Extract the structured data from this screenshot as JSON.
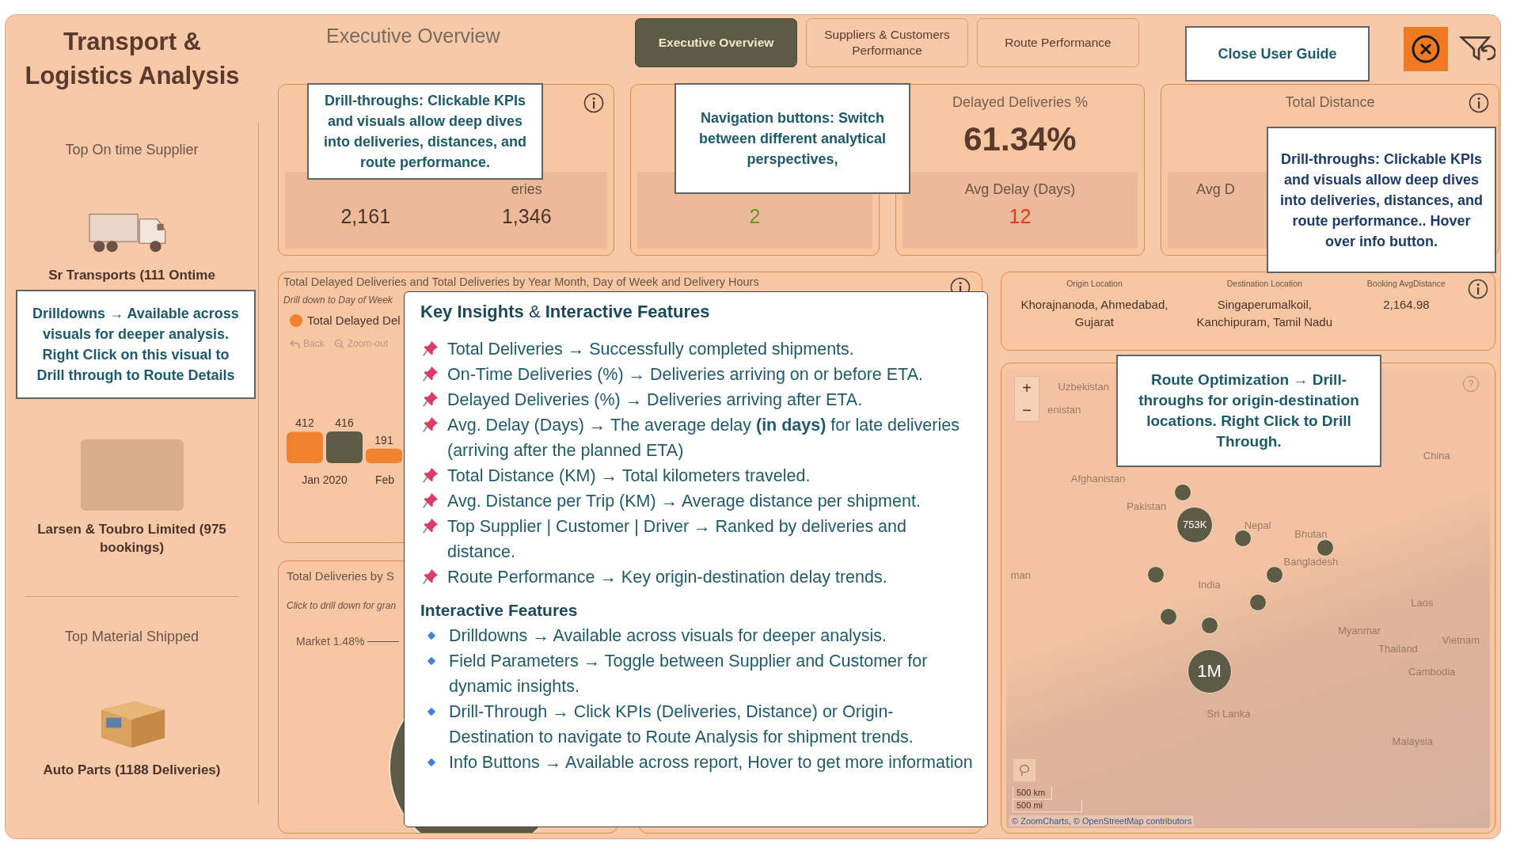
{
  "sidebar": {
    "title": "Transport & Logistics Analysis",
    "sections": [
      {
        "heading": "Top On time Supplier",
        "kind": "truck",
        "caption": "Sr Transports (111 Ontime"
      },
      {
        "kind": "photo",
        "caption": "Larsen & Toubro Limited (975 bookings)"
      },
      {
        "heading": "Top Material Shipped",
        "kind": "box",
        "caption": "Auto Parts (1188 Deliveries)"
      }
    ]
  },
  "header": {
    "title": "Executive Overview",
    "tabs": [
      {
        "label": "Executive Overview",
        "selected": true
      },
      {
        "label": "Suppliers & Customers Performance",
        "selected": false
      },
      {
        "label": "Route Performance",
        "selected": false
      }
    ]
  },
  "kpis": [
    {
      "info_button": true,
      "subs": [
        {
          "value": "2,161"
        },
        {
          "label": "eries",
          "value": "1,346"
        }
      ]
    },
    {
      "info_button": false,
      "subs": [
        {
          "value": "2",
          "color": "#5f9a1c"
        }
      ]
    },
    {
      "info_button": false,
      "title": "Delayed Deliveries %",
      "value": "61.34%",
      "subs": [
        {
          "label": "Avg Delay (Days)",
          "value": "12",
          "color": "#e8381c"
        }
      ]
    },
    {
      "info_button": true,
      "title": "Total Distance",
      "subs": [
        {
          "label": "Avg D"
        }
      ]
    }
  ],
  "delivery_chart": {
    "title": "Total Delayed Deliveries and Total Deliveries by Year Month, Day of Week and Delivery Hours",
    "subtitle": "Drill down to Day of Week",
    "controls": [
      {
        "kind": "back",
        "label": "Back",
        "disabled": true
      },
      {
        "kind": "zoom",
        "label": "Zoom-out",
        "disabled": true
      }
    ],
    "chart_data": {
      "type": "bar",
      "categories": [
        "Jan 2020",
        "Feb"
      ],
      "series": [
        {
          "name": "Total Delayed Del",
          "color": "#f0812f",
          "values": [
            412,
            191
          ]
        },
        {
          "color": "#5d5a45",
          "values": [
            416,
            null
          ]
        }
      ],
      "data_labels": true
    }
  },
  "share_chart": {
    "title": "Total Deliveries by S",
    "subtitle": "Click to drill down for gran",
    "slice_label": "Market 1.48%"
  },
  "route_table": {
    "columns": [
      "Origin Location",
      "Destination Location",
      "Booking AvgDistance"
    ],
    "rows": [
      [
        "Khorajnanoda, Ahmedabad, Gujarat",
        "Singaperumalkoil, Kanchipuram, Tamil Nadu",
        "2,164.98"
      ]
    ]
  },
  "map": {
    "labels": [
      "Uzbekistan",
      "enistan",
      "China",
      "Afghanistan",
      "Pakistan",
      "Nepal",
      "Bhutan",
      "Bangladesh",
      "India",
      "man",
      "Laos",
      "Myanmar",
      "Vietnam",
      "Thailand",
      "Cambodia",
      "Sri Lanka",
      "Malaysia"
    ],
    "bubbles": [
      {
        "kind": "small"
      },
      {
        "kind": "large",
        "label": "753K"
      },
      {
        "kind": "small"
      },
      {
        "kind": "small"
      },
      {
        "kind": "small"
      },
      {
        "kind": "small"
      },
      {
        "kind": "small"
      },
      {
        "kind": "small"
      },
      {
        "kind": "small"
      },
      {
        "kind": "large",
        "label": "1M"
      }
    ],
    "zoom_buttons": [
      "+",
      "−"
    ],
    "help": "?",
    "scale": [
      "500 km",
      "500 mi"
    ],
    "attribution": "© ZoomCharts, © OpenStreetMap contributors"
  },
  "guide": {
    "callouts": [
      "Close User Guide",
      "Drill-throughs: Clickable KPIs and visuals allow deep dives into deliveries, distances, and route performance.",
      "Navigation buttons: Switch between different analytical perspectives,",
      "Drill-throughs: Clickable KPIs and visuals allow deep dives into deliveries, distances, and route performance.. Hover over info button.",
      "Drilldowns → Available across visuals for deeper analysis. Right Click on this visual to Drill through to Route Details",
      "Route Optimization → Drill-throughs for origin-destination locations. Right Click to Drill Through."
    ],
    "popup": {
      "heading": "**Key Insights** & **Interactive Features**",
      "sections": [
        {
          "kind": "pin",
          "items": [
            "Total Deliveries → Successfully completed shipments.",
            "On-Time Deliveries (%) → Deliveries arriving on or before ETA.",
            "Delayed Deliveries (%) → Deliveries arriving after ETA.",
            "Avg. Delay (Days) → The average delay **(in days)** for late deliveries (arriving after the planned ETA)",
            "Total Distance (KM) → Total kilometers traveled.",
            "Avg. Distance per Trip (KM) → Average distance per shipment.",
            "Top Supplier | Customer | Driver → Ranked by deliveries and distance.",
            "Route Performance → Key origin-destination delay trends."
          ]
        },
        {
          "heading": "Interactive Features",
          "kind": "diamond",
          "items": [
            "Drilldowns → Available across visuals for deeper analysis.",
            "Field Parameters → Toggle between Supplier and Customer for dynamic insights.",
            "Drill-Through → Click KPIs (Deliveries, Distance) or Origin-Destination to navigate to Route Analysis for shipment trends.",
            "Info Buttons → Available across report, Hover to get more information"
          ]
        }
      ]
    }
  }
}
